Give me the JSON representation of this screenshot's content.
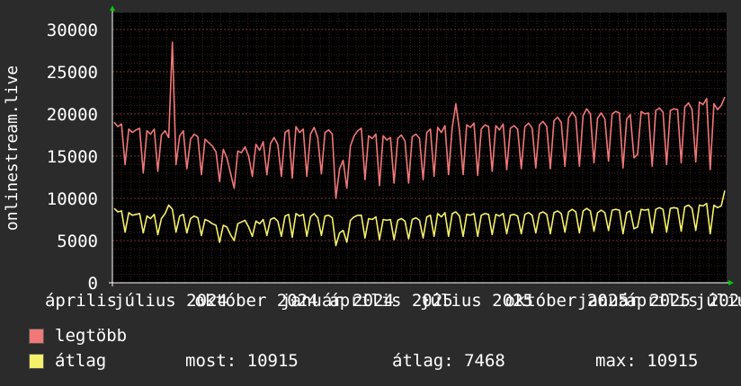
{
  "chart_data": {
    "type": "line",
    "ylabel": "onlinestream.live",
    "ylim": [
      0,
      32000
    ],
    "y_ticks": [
      0,
      5000,
      10000,
      15000,
      20000,
      25000,
      30000
    ],
    "x_tick_labels": [
      "április",
      "július 2024",
      "október 2024",
      "január 2024",
      "április 2025",
      "július 2025",
      "október 2025",
      "január 2025",
      "április 2026",
      "július"
    ],
    "grid": true,
    "colors": {
      "background": "#2b2b2b",
      "plot": "#000000",
      "grid": "#5a2a2a",
      "axis": "#ffffff",
      "max_series": "#f07878",
      "avg_series": "#f5f06a"
    },
    "series": [
      {
        "name": "legtöbb",
        "color": "#f07878",
        "values": [
          19000,
          18500,
          18800,
          14000,
          18200,
          17800,
          18100,
          18300,
          13000,
          18000,
          17600,
          18200,
          13200,
          17500,
          18000,
          17200,
          28500,
          14000,
          17400,
          18000,
          13500,
          17000,
          17600,
          17300,
          12800,
          17000,
          16600,
          16200,
          15500,
          12000,
          15800,
          14800,
          13000,
          11200,
          15600,
          15400,
          16100,
          15000,
          12600,
          16400,
          15700,
          16700,
          12800,
          16500,
          17200,
          16400,
          12600,
          17800,
          18100,
          12400,
          18500,
          17800,
          18200,
          12600,
          17600,
          18400,
          17200,
          12900,
          17800,
          18100,
          17600,
          10000,
          13500,
          14500,
          11200,
          16200,
          17400,
          18000,
          18300,
          12200,
          17400,
          17100,
          17600,
          11500,
          17400,
          16900,
          17200,
          11800,
          17100,
          17500,
          16800,
          11800,
          17300,
          17600,
          17100,
          12200,
          17800,
          18200,
          12600,
          18400,
          17800,
          18600,
          12800,
          18400,
          21200,
          18000,
          12800,
          18700,
          18400,
          18900,
          12700,
          18200,
          18700,
          18500,
          13200,
          18600,
          18100,
          18800,
          13400,
          18300,
          18600,
          18200,
          13500,
          18500,
          18900,
          18300,
          13600,
          18700,
          19100,
          18500,
          13500,
          19200,
          19600,
          19000,
          13800,
          19500,
          20200,
          19600,
          13800,
          19800,
          20600,
          20000,
          14200,
          19500,
          20100,
          19400,
          14400,
          20000,
          20300,
          20100,
          13600,
          19400,
          19900,
          14800,
          15200,
          20300,
          20000,
          20100,
          13800,
          20400,
          20700,
          20200,
          14000,
          20400,
          20600,
          20500,
          14200,
          20800,
          21300,
          20500,
          14300,
          21400,
          21100,
          21800,
          13400,
          21200,
          20500,
          21000,
          22000
        ]
      },
      {
        "name": "átlag",
        "color": "#f5f06a",
        "values": [
          8800,
          8400,
          8500,
          6000,
          8300,
          8000,
          8100,
          8200,
          5900,
          7900,
          7600,
          8100,
          5700,
          7600,
          8200,
          9200,
          8700,
          6000,
          7900,
          8100,
          5900,
          7600,
          7900,
          7700,
          5600,
          7500,
          7300,
          7000,
          6800,
          4800,
          6800,
          6600,
          5700,
          5000,
          7000,
          7200,
          7400,
          6600,
          5500,
          7300,
          7000,
          7500,
          5600,
          7500,
          7700,
          7300,
          5500,
          7900,
          8100,
          5400,
          8200,
          7900,
          8100,
          5500,
          7800,
          8200,
          7700,
          5600,
          7900,
          8000,
          7700,
          4400,
          5900,
          6200,
          4800,
          7400,
          7800,
          8000,
          8000,
          5300,
          7600,
          7500,
          7800,
          5100,
          7500,
          7400,
          7500,
          5100,
          7400,
          7600,
          7300,
          5200,
          7500,
          7700,
          7400,
          5300,
          7800,
          8000,
          5500,
          8200,
          7800,
          8300,
          5500,
          8200,
          8400,
          7900,
          5500,
          8100,
          8000,
          8200,
          5500,
          8000,
          8200,
          8100,
          5700,
          8100,
          7900,
          8200,
          5800,
          8000,
          8100,
          7900,
          5800,
          8100,
          8300,
          8000,
          5900,
          8200,
          8400,
          8100,
          5800,
          8300,
          8500,
          8200,
          6000,
          8400,
          8700,
          8400,
          5900,
          8500,
          8800,
          8500,
          6100,
          8300,
          8600,
          8300,
          6200,
          8600,
          8700,
          8600,
          5800,
          8300,
          8500,
          6400,
          6600,
          8700,
          8600,
          8700,
          5900,
          8700,
          8900,
          8700,
          6000,
          8800,
          8900,
          8800,
          6100,
          9000,
          9200,
          8800,
          6200,
          9200,
          9100,
          9400,
          5800,
          9200,
          8900,
          9100,
          10915
        ]
      }
    ]
  },
  "legend": {
    "max_label": "legtöbb",
    "avg_label": "átlag",
    "most_text": "most: 10915",
    "avg_text": "átlag: 7468",
    "max_text": "max: 10915"
  }
}
